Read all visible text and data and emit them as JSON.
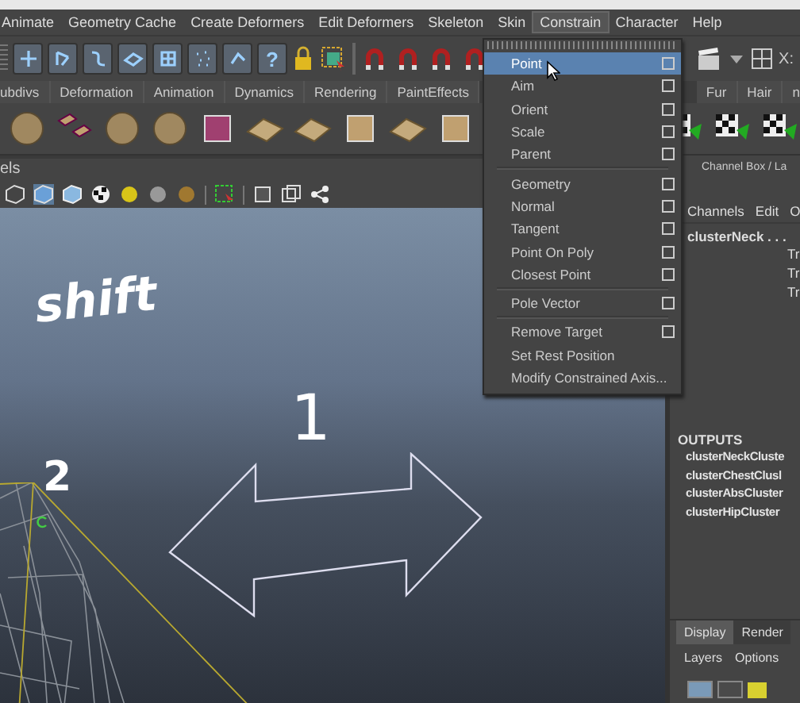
{
  "menubar": [
    {
      "label": "Animate",
      "selected": false
    },
    {
      "label": "Geometry Cache",
      "selected": false
    },
    {
      "label": "Create Deformers",
      "selected": false
    },
    {
      "label": "Edit Deformers",
      "selected": false
    },
    {
      "label": "Skeleton",
      "selected": false
    },
    {
      "label": "Skin",
      "selected": false
    },
    {
      "label": "Constrain",
      "selected": true
    },
    {
      "label": "Character",
      "selected": false
    },
    {
      "label": "Help",
      "selected": false
    }
  ],
  "status_line": {
    "help": "?",
    "field_label": "X:"
  },
  "shelf_tabs": [
    {
      "label": "ubdivs",
      "selected": false
    },
    {
      "label": "Deformation",
      "selected": false
    },
    {
      "label": "Animation",
      "selected": false
    },
    {
      "label": "Dynamics",
      "selected": false
    },
    {
      "label": "Rendering",
      "selected": false
    },
    {
      "label": "PaintEffects",
      "selected": false
    }
  ],
  "shelf_tabs_right": [
    {
      "label": "Fur",
      "selected": false
    },
    {
      "label": "Hair",
      "selected": false
    },
    {
      "label": "n",
      "selected": false
    }
  ],
  "panel_menu": "els",
  "constrain_menu": {
    "groups": [
      [
        {
          "label": "Point",
          "selected": true,
          "option_box": true
        },
        {
          "label": "Aim",
          "selected": false,
          "option_box": true
        },
        {
          "label": "Orient",
          "selected": false,
          "option_box": true
        },
        {
          "label": "Scale",
          "selected": false,
          "option_box": true
        },
        {
          "label": "Parent",
          "selected": false,
          "option_box": true
        }
      ],
      [
        {
          "label": "Geometry",
          "selected": false,
          "option_box": true
        },
        {
          "label": "Normal",
          "selected": false,
          "option_box": true
        },
        {
          "label": "Tangent",
          "selected": false,
          "option_box": true
        },
        {
          "label": "Point On Poly",
          "selected": false,
          "option_box": true
        },
        {
          "label": "Closest Point",
          "selected": false,
          "option_box": true
        }
      ],
      [
        {
          "label": "Pole Vector",
          "selected": false,
          "option_box": true
        }
      ],
      [
        {
          "label": "Remove Target",
          "selected": false,
          "option_box": true
        },
        {
          "label": "Set Rest Position",
          "selected": false,
          "option_box": false
        },
        {
          "label": "Modify Constrained Axis...",
          "selected": false,
          "option_box": false
        }
      ]
    ]
  },
  "channel_box": {
    "title": "Channel Box / La",
    "menu": [
      "Channels",
      "Edit",
      "O"
    ],
    "node": "clusterNeck . . .",
    "attributes": [
      "Tr",
      "Tr",
      "Tr"
    ],
    "outputs_heading": "OUTPUTS",
    "outputs": [
      "clusterNeckCluste",
      "clusterChestClusl",
      "clusterAbsCluster",
      "clusterHipCluster"
    ]
  },
  "layer_editor": {
    "tabs": [
      {
        "label": "Display",
        "selected": true
      },
      {
        "label": "Render",
        "selected": false
      }
    ],
    "menu": [
      "Layers",
      "Options"
    ],
    "toggles": [
      {
        "on": true
      },
      {
        "on": false
      }
    ]
  },
  "annotations": {
    "key": "shift",
    "first": "1",
    "second": "2"
  }
}
